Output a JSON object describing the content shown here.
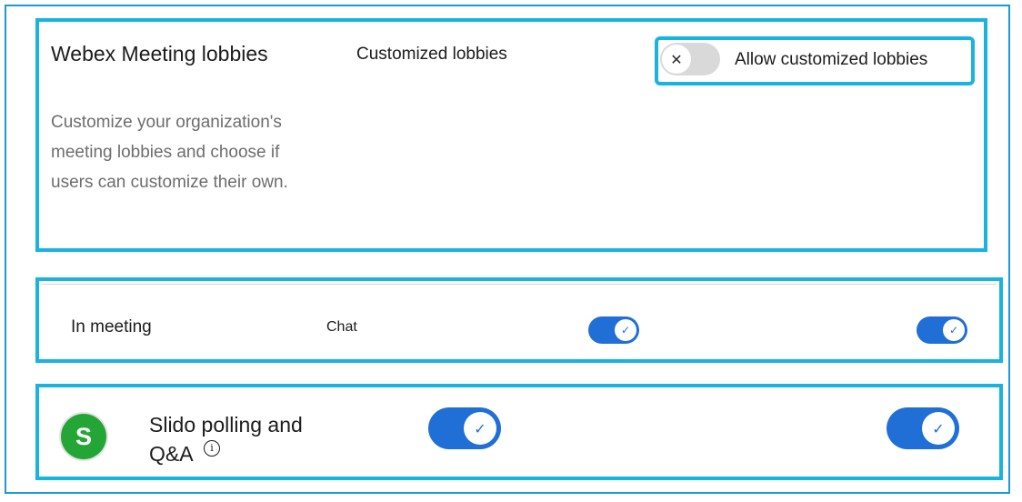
{
  "lobbies": {
    "title": "Webex Meeting lobbies",
    "subtitle": "Customized lobbies",
    "description": "Customize your organization's meeting lobbies and choose if users can customize their own.",
    "allow_toggle": {
      "label": "Allow customized lobbies",
      "state": "off",
      "icon": "x-icon"
    }
  },
  "in_meeting": {
    "title": "In meeting",
    "subtitle": "Chat",
    "toggles": [
      {
        "state": "on",
        "icon": "check-icon"
      },
      {
        "state": "on",
        "icon": "check-icon"
      }
    ]
  },
  "slido": {
    "avatar_letter": "S",
    "title": "Slido polling and Q&A",
    "info_icon": "info-icon",
    "toggles": [
      {
        "state": "on",
        "icon": "check-icon"
      },
      {
        "state": "on",
        "icon": "check-icon"
      }
    ]
  },
  "colors": {
    "highlight": "#19b3e0",
    "toggle_on": "#1f6fd6",
    "toggle_off": "#d9d9d9",
    "slido_green": "#23a636"
  }
}
